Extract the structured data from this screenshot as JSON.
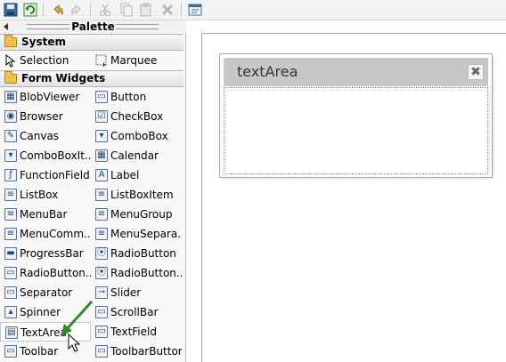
{
  "toolbar": {
    "buttons": [
      "save-icon",
      "refresh-icon",
      "undo-icon",
      "redo-icon",
      "cut-icon",
      "copy-icon",
      "paste-icon",
      "delete-icon",
      "layout-icon"
    ]
  },
  "palette": {
    "title": "Palette",
    "categories": [
      {
        "label": "System",
        "items": [
          {
            "label": "Selection",
            "icon": "cursor-icon"
          },
          {
            "label": "Marquee",
            "icon": "marquee-icon"
          }
        ]
      },
      {
        "label": "Form Widgets",
        "items": [
          {
            "label": "BlobViewer"
          },
          {
            "label": "Button"
          },
          {
            "label": "Browser"
          },
          {
            "label": "CheckBox"
          },
          {
            "label": "Canvas"
          },
          {
            "label": "ComboBox"
          },
          {
            "label": "ComboBoxIt..."
          },
          {
            "label": "Calendar"
          },
          {
            "label": "FunctionField"
          },
          {
            "label": "Label"
          },
          {
            "label": "ListBox"
          },
          {
            "label": "ListBoxItem"
          },
          {
            "label": "MenuBar"
          },
          {
            "label": "MenuGroup"
          },
          {
            "label": "MenuComm..."
          },
          {
            "label": "MenuSepara..."
          },
          {
            "label": "ProgressBar"
          },
          {
            "label": "RadioButton"
          },
          {
            "label": "RadioButton..."
          },
          {
            "label": "RadioButton..."
          },
          {
            "label": "Separator"
          },
          {
            "label": "Slider"
          },
          {
            "label": "Spinner"
          },
          {
            "label": "ScrollBar"
          },
          {
            "label": "TextArea"
          },
          {
            "label": "TextField"
          },
          {
            "label": "Toolbar"
          },
          {
            "label": "ToolbarButton"
          }
        ]
      }
    ]
  },
  "editor": {
    "widget": {
      "title": "textArea",
      "close_symbol": "✖"
    }
  },
  "colors": {
    "drag_arrow": "#2e8b2e",
    "widget_header": "#c7c7c7"
  }
}
